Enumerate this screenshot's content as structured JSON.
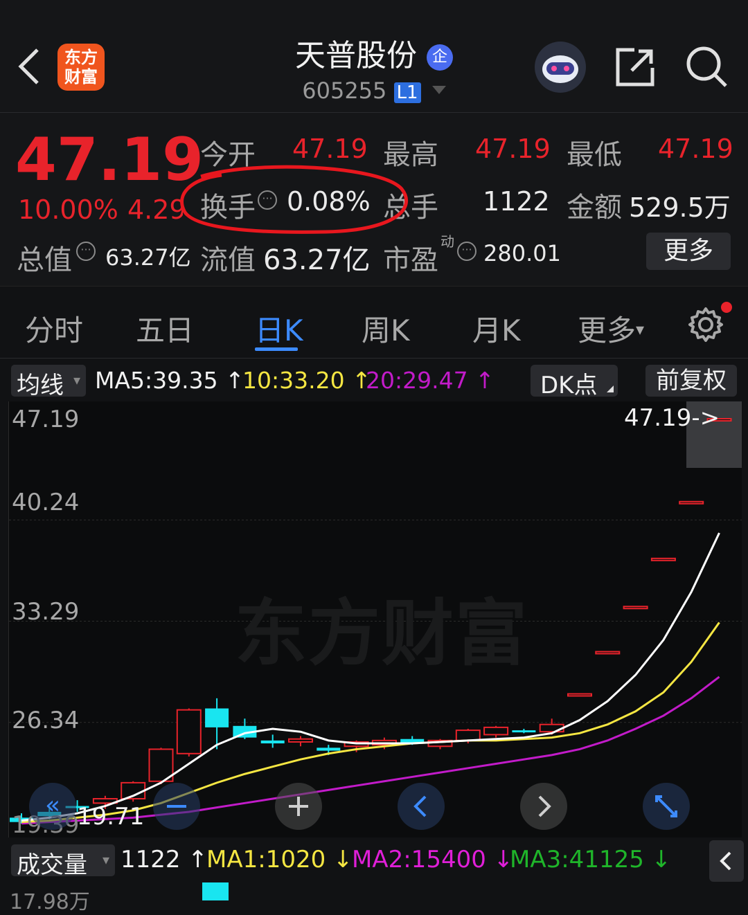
{
  "header": {
    "logo_text": "东方\n财富",
    "stock_name": "天普股份",
    "badge_name": "企",
    "stock_code": "605255",
    "level_tag": "L1"
  },
  "quote": {
    "price": "47.19",
    "change_pct": "10.00%",
    "change_abs": "4.29",
    "open_label": "今开",
    "open_value": "47.19",
    "high_label": "最高",
    "high_value": "47.19",
    "low_label": "最低",
    "low_value": "47.19",
    "turnover_label": "换手",
    "turnover_value": "0.08%",
    "volume_label": "总手",
    "volume_value": "1122",
    "amount_label": "金额",
    "amount_value": "529.5万",
    "mktcap_label": "总值",
    "mktcap_value": "63.27亿",
    "float_label": "流值",
    "float_value": "63.27亿",
    "pe_label": "市盈",
    "pe_sup": "动",
    "pe_value": "280.01",
    "more_button": "更多"
  },
  "tabs": [
    "分时",
    "五日",
    "日K",
    "周K",
    "月K",
    "更多"
  ],
  "active_tab": "日K",
  "indicator_bar": {
    "ma_selector": "均线",
    "ma5": "MA5:39.35",
    "ma10": "10:33.20",
    "ma20": "20:29.47",
    "dk_button": "DK点",
    "adjust_button": "前复权"
  },
  "chart": {
    "y_ticks": [
      "47.19",
      "40.24",
      "33.29",
      "26.34"
    ],
    "last_price_label": "47.19->",
    "low_label": "19.71",
    "low_axis_label": "19.39",
    "watermark": "东方财富",
    "colors": {
      "up": "#e8232b",
      "down": "#19e5f0",
      "ma5": "#ffffff",
      "ma10": "#f5e642",
      "ma20": "#c21bc9"
    }
  },
  "chart_data": {
    "type": "candlestick",
    "ylim": [
      19.39,
      47.19
    ],
    "candles": [
      {
        "o": 19.8,
        "h": 20.1,
        "l": 19.39,
        "c": 19.5
      },
      {
        "o": 20.2,
        "h": 20.6,
        "l": 19.7,
        "c": 19.9
      },
      {
        "o": 20.6,
        "h": 21.0,
        "l": 20.2,
        "c": 20.5
      },
      {
        "o": 20.8,
        "h": 21.3,
        "l": 20.4,
        "c": 21.1
      },
      {
        "o": 21.1,
        "h": 22.3,
        "l": 20.9,
        "c": 22.2
      },
      {
        "o": 22.3,
        "h": 24.6,
        "l": 22.1,
        "c": 24.5
      },
      {
        "o": 24.2,
        "h": 27.3,
        "l": 24.0,
        "c": 27.2
      },
      {
        "o": 27.3,
        "h": 28.0,
        "l": 24.5,
        "c": 26.0
      },
      {
        "o": 26.1,
        "h": 26.6,
        "l": 25.2,
        "c": 25.3
      },
      {
        "o": 25.1,
        "h": 25.5,
        "l": 24.6,
        "c": 24.9
      },
      {
        "o": 25.0,
        "h": 25.4,
        "l": 24.7,
        "c": 25.2
      },
      {
        "o": 24.6,
        "h": 24.8,
        "l": 24.1,
        "c": 24.4
      },
      {
        "o": 24.7,
        "h": 25.1,
        "l": 24.3,
        "c": 25.0
      },
      {
        "o": 24.8,
        "h": 25.3,
        "l": 24.5,
        "c": 25.1
      },
      {
        "o": 25.2,
        "h": 25.4,
        "l": 24.8,
        "c": 24.9
      },
      {
        "o": 24.7,
        "h": 25.2,
        "l": 24.5,
        "c": 25.1
      },
      {
        "o": 25.1,
        "h": 25.9,
        "l": 24.9,
        "c": 25.8
      },
      {
        "o": 25.5,
        "h": 26.1,
        "l": 25.3,
        "c": 26.0
      },
      {
        "o": 25.8,
        "h": 25.9,
        "l": 25.6,
        "c": 25.7
      },
      {
        "o": 25.7,
        "h": 26.6,
        "l": 25.5,
        "c": 26.2
      },
      {
        "o": 28.3,
        "h": 28.3,
        "l": 28.3,
        "c": 28.3
      },
      {
        "o": 31.2,
        "h": 31.2,
        "l": 31.2,
        "c": 31.2
      },
      {
        "o": 34.3,
        "h": 34.3,
        "l": 34.3,
        "c": 34.3
      },
      {
        "o": 37.6,
        "h": 37.6,
        "l": 37.6,
        "c": 37.6
      },
      {
        "o": 41.5,
        "h": 41.5,
        "l": 41.5,
        "c": 41.5
      },
      {
        "o": 47.19,
        "h": 47.19,
        "l": 47.19,
        "c": 47.19
      }
    ],
    "ma5": [
      19.6,
      19.8,
      20.1,
      20.6,
      21.3,
      22.2,
      23.5,
      24.8,
      25.6,
      25.9,
      25.7,
      25.1,
      24.9,
      24.9,
      24.9,
      25.0,
      25.1,
      25.2,
      25.3,
      25.6,
      26.5,
      27.8,
      29.6,
      32.0,
      35.3,
      39.35
    ],
    "ma10": [
      19.5,
      19.6,
      19.8,
      20.0,
      20.3,
      20.8,
      21.5,
      22.2,
      22.8,
      23.3,
      23.8,
      24.2,
      24.5,
      24.7,
      24.9,
      25.0,
      25.1,
      25.1,
      25.2,
      25.3,
      25.6,
      26.2,
      27.1,
      28.4,
      30.5,
      33.2
    ],
    "ma20": [
      19.4,
      19.5,
      19.6,
      19.7,
      19.8,
      20.0,
      20.2,
      20.5,
      20.8,
      21.1,
      21.4,
      21.7,
      22.0,
      22.3,
      22.6,
      22.9,
      23.2,
      23.5,
      23.8,
      24.1,
      24.5,
      25.1,
      25.9,
      26.8,
      28.0,
      29.47
    ]
  },
  "volume_bar": {
    "selector": "成交量",
    "value": "1122",
    "ma1": "MA1:1020",
    "ma2": "MA2:15400",
    "ma3": "MA3:41125",
    "axis_label": "17.98万"
  }
}
